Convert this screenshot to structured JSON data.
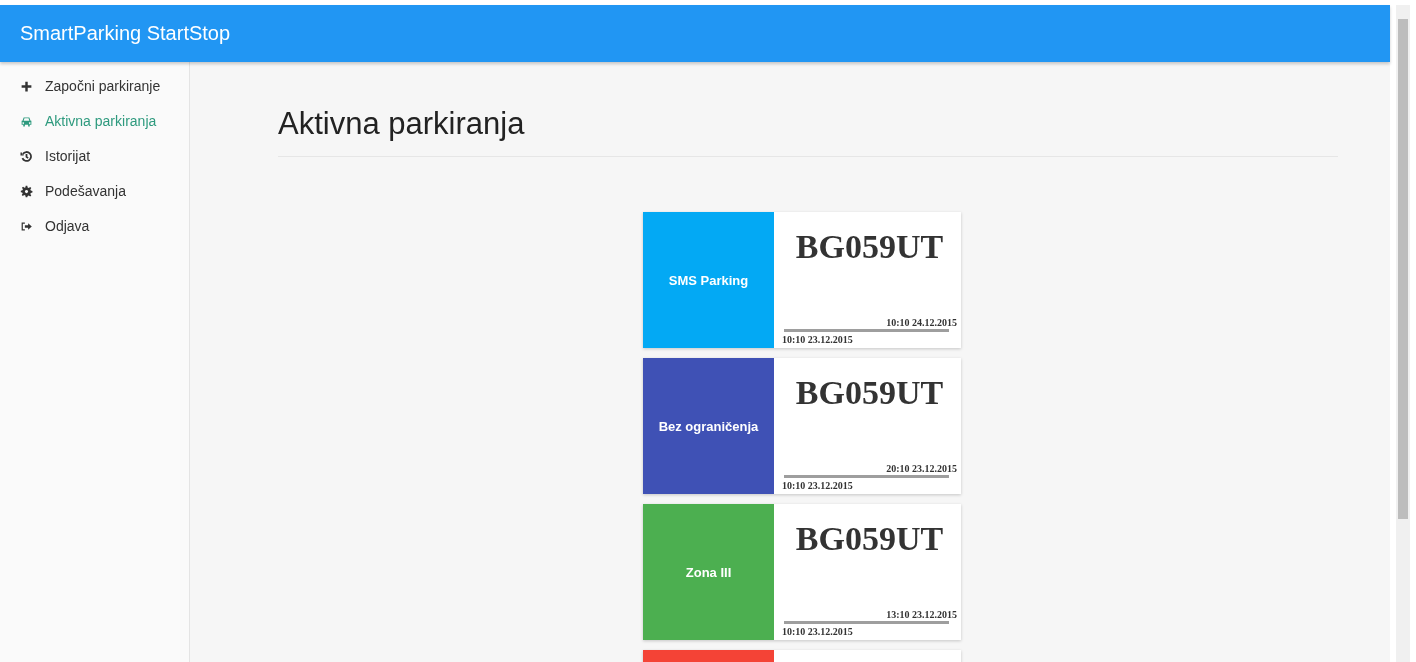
{
  "app_bar": {
    "title": "SmartParking StartStop"
  },
  "sidebar": {
    "items": [
      {
        "label": "Započni parkiranje",
        "kind": "plus",
        "selected": false
      },
      {
        "label": "Aktivna parkiranja",
        "kind": "car",
        "selected": true
      },
      {
        "label": "Istorijat",
        "kind": "history",
        "selected": false
      },
      {
        "label": "Podešavanja",
        "kind": "gear",
        "selected": false
      },
      {
        "label": "Odjava",
        "kind": "logout",
        "selected": false
      }
    ]
  },
  "page": {
    "heading": "Aktivna parkiranja"
  },
  "parkings": [
    {
      "zone": "SMS Parking",
      "color": "#03a9f4",
      "plate": "BG059UT",
      "end": "10:10 24.12.2015",
      "start": "10:10 23.12.2015"
    },
    {
      "zone": "Bez ograničenja",
      "color": "#3f51b5",
      "plate": "BG059UT",
      "end": "20:10 23.12.2015",
      "start": "10:10 23.12.2015"
    },
    {
      "zone": "Zona III",
      "color": "#4caf50",
      "plate": "BG059UT",
      "end": "13:10 23.12.2015",
      "start": "10:10 23.12.2015"
    },
    {
      "color": "#f44336"
    }
  ]
}
